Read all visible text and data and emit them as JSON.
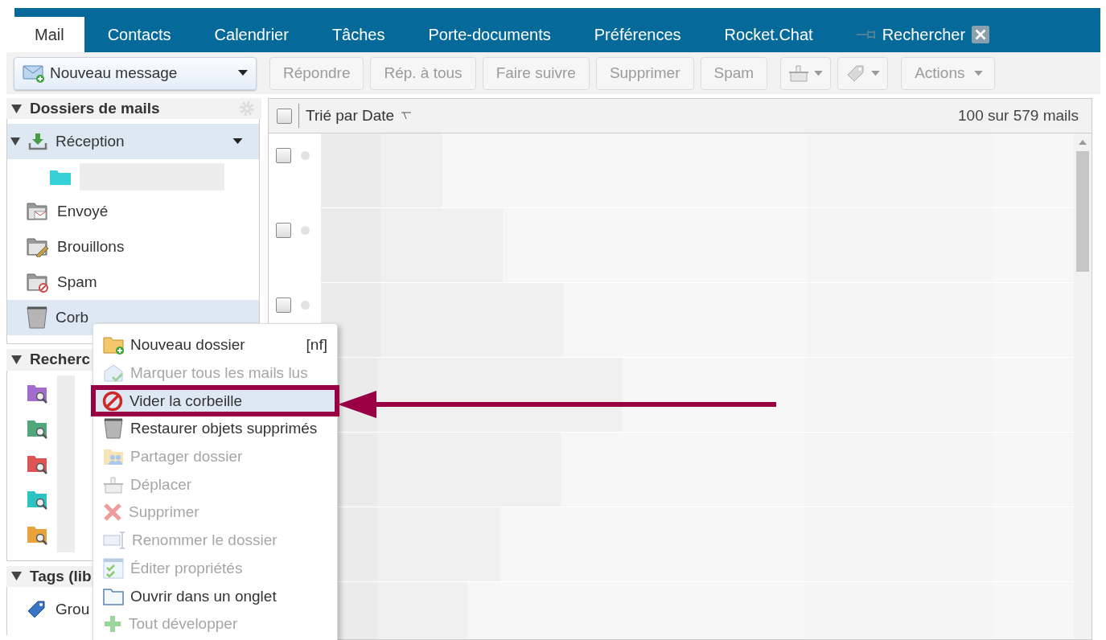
{
  "tabs": [
    {
      "label": "Mail",
      "selected": true,
      "kind": "module"
    },
    {
      "label": "Contacts",
      "selected": false,
      "kind": "module"
    },
    {
      "label": "Calendrier",
      "selected": false,
      "kind": "module"
    },
    {
      "label": "Tâches",
      "selected": false,
      "kind": "module"
    },
    {
      "label": "Porte-documents",
      "selected": false,
      "kind": "module"
    },
    {
      "label": "Préférences",
      "selected": false,
      "kind": "module"
    },
    {
      "label": "Rocket.Chat",
      "selected": false,
      "kind": "module"
    },
    {
      "label": "Rechercher",
      "selected": false,
      "kind": "search"
    }
  ],
  "toolbar": {
    "new_message": "Nouveau message",
    "buttons": [
      {
        "label": "Répondre",
        "disabled": true
      },
      {
        "label": "Rép. à tous",
        "disabled": true
      },
      {
        "label": "Faire suivre",
        "disabled": true
      },
      {
        "label": "Supprimer",
        "disabled": true
      },
      {
        "label": "Spam",
        "disabled": true
      }
    ],
    "icon_buttons": [
      {
        "kind": "move",
        "disabled": true
      },
      {
        "kind": "tag",
        "disabled": true
      }
    ],
    "actions": {
      "label": "Actions",
      "disabled": true
    }
  },
  "sidebar": {
    "sections": [
      {
        "title": "Dossiers de mails",
        "expanded": true,
        "items": [
          {
            "kind": "inbox",
            "label": "Réception",
            "selected": true,
            "expanded": true,
            "children": [
              {
                "kind": "folder",
                "color": "#36d0d8",
                "selected": false
              }
            ]
          },
          {
            "kind": "sent",
            "label": "Envoyé",
            "selected": false
          },
          {
            "kind": "drafts",
            "label": "Brouillons",
            "selected": false
          },
          {
            "kind": "spam",
            "label": "Spam",
            "selected": false
          },
          {
            "kind": "trash",
            "label": "Corb",
            "selected": true
          }
        ]
      },
      {
        "title": "Recherc",
        "expanded": true,
        "items": [
          {
            "kind": "search",
            "color": "#a36ccc",
            "selected": false
          },
          {
            "kind": "search",
            "color": "#4fa77a",
            "selected": false
          },
          {
            "kind": "search",
            "color": "#dc5454",
            "selected": false
          },
          {
            "kind": "search",
            "color": "#2ec3c3",
            "selected": false
          },
          {
            "kind": "search",
            "color": "#e9a33c",
            "selected": false
          }
        ]
      },
      {
        "title": "Tags (lib",
        "expanded": true,
        "items": [
          {
            "kind": "tag",
            "label": "Grou",
            "selected": false
          }
        ]
      }
    ]
  },
  "mail_list": {
    "select_all_checked": false,
    "sort_label": "Trié par Date",
    "count": "100 sur 579 mails",
    "rows": [
      {
        "checked": false
      },
      {
        "checked": false
      },
      {
        "checked": false
      },
      {
        "kind": "covered"
      },
      {
        "kind": "covered"
      },
      {
        "kind": "covered"
      },
      {
        "kind": "covered"
      }
    ]
  },
  "context_menu": {
    "items": [
      {
        "label": "Nouveau dossier",
        "shortcut": "[nf]",
        "disabled": false,
        "selected": false
      },
      {
        "label": "Marquer tous les mails lus",
        "disabled": true,
        "selected": false
      },
      {
        "label": "Vider la corbeille",
        "disabled": false,
        "selected": true
      },
      {
        "label": "Restaurer objets supprimés",
        "disabled": false,
        "selected": false
      },
      {
        "label": "Partager dossier",
        "disabled": true,
        "selected": false
      },
      {
        "label": "Déplacer",
        "disabled": true,
        "selected": false
      },
      {
        "label": "Supprimer",
        "disabled": true,
        "selected": false
      },
      {
        "label": "Renommer le dossier",
        "disabled": true,
        "selected": false
      },
      {
        "label": "Éditer propriétés",
        "disabled": true,
        "selected": false
      },
      {
        "label": "Ouvrir dans un onglet",
        "disabled": false,
        "selected": false
      },
      {
        "label": "Tout développer",
        "disabled": true,
        "selected": false
      }
    ]
  }
}
